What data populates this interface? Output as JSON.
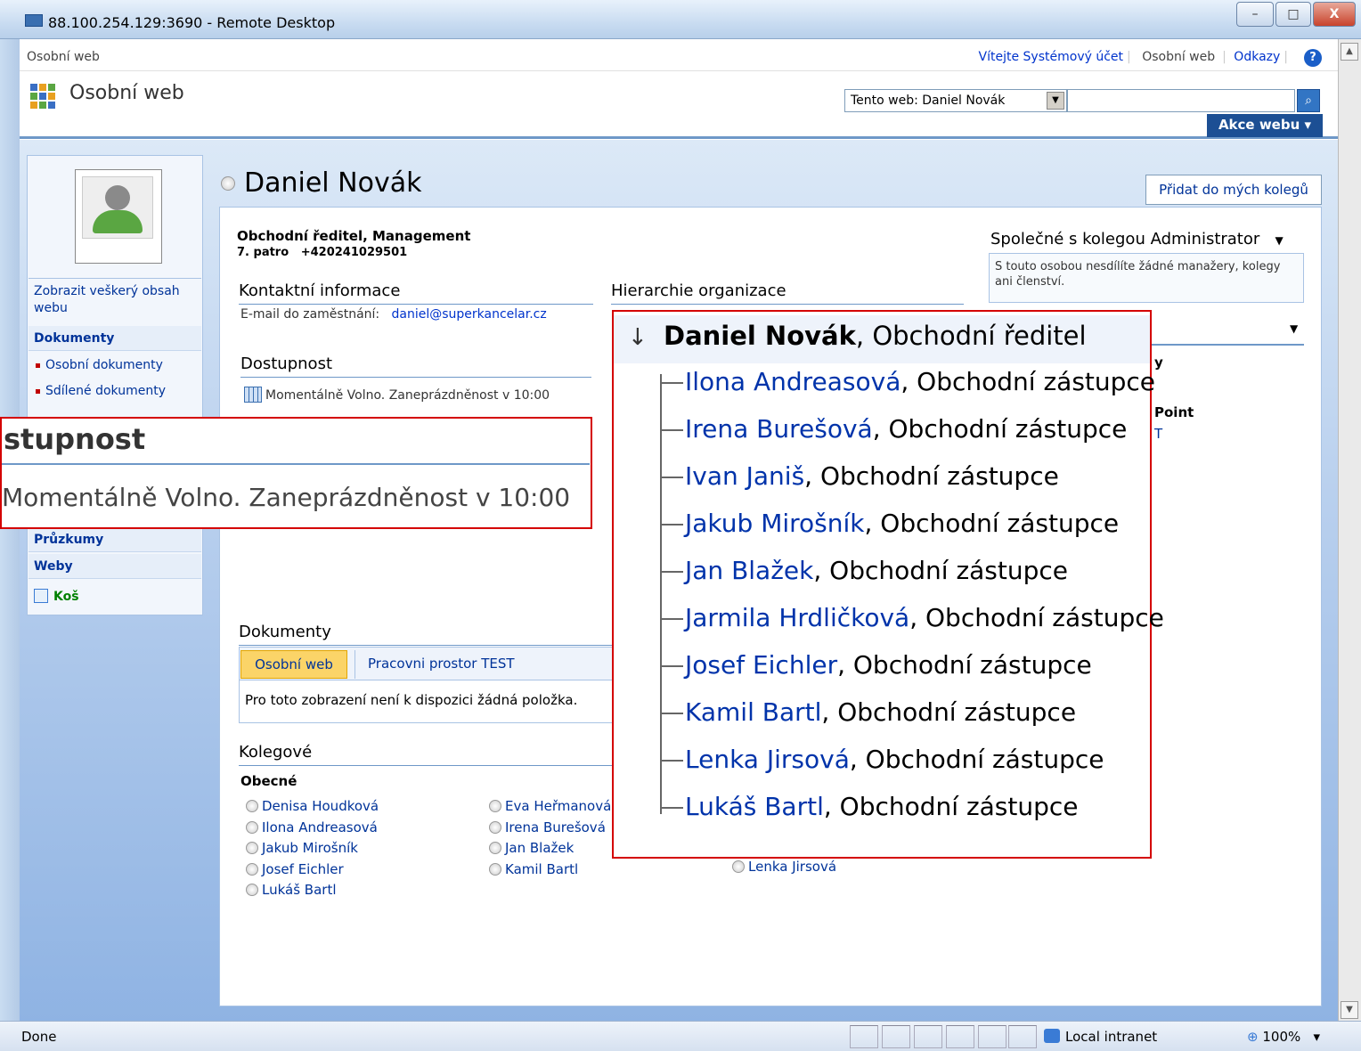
{
  "window": {
    "title": "88.100.254.129:3690 - Remote Desktop",
    "minimize": "–",
    "maximize": "□",
    "close": "X"
  },
  "topbar": {
    "site": "Osobní web",
    "welcome": "Vítejte Systémový účet",
    "my_site": "Osobní web",
    "links": "Odkazy",
    "help": "?"
  },
  "header": {
    "title": "Osobní web",
    "scope": "Tento web: Daniel Novák",
    "search_placeholder": "",
    "site_actions": "Akce webu ▾"
  },
  "nav": {
    "view_all": "Zobrazit veškerý obsah webu",
    "documents": "Dokumenty",
    "doc_items": [
      "Osobní dokumenty",
      "Sdílené dokumenty"
    ],
    "surveys": "Průzkumy",
    "sites": "Weby",
    "recycle": "Koš"
  },
  "person": {
    "name": "Daniel Novák",
    "add_colleague": "Přidat do mých kolegů",
    "title_line": "Obchodní ředitel, Management",
    "floor": "7. patro",
    "phone": "+420241029501"
  },
  "contact": {
    "heading": "Kontaktní informace",
    "email_label": "E-mail do zaměstnání:",
    "email": "daniel@superkancelar.cz"
  },
  "availability": {
    "heading": "Dostupnost",
    "status": "Momentálně Volno. Zaneprázdněnost v 10:00"
  },
  "availability_zoom": {
    "heading": "stupnost",
    "status": "Momentálně Volno. Zaneprázdněnost v 10:00"
  },
  "hierarchy": {
    "heading": "Hierarchie organizace",
    "manager_name": "Daniel Novák",
    "manager_role": ", Obchodní ředitel",
    "reports": [
      {
        "name": "Ilona Andreasová",
        "role": ", Obchodní zástupce"
      },
      {
        "name": "Irena Burešová",
        "role": ", Obchodní zástupce"
      },
      {
        "name": "Ivan Janiš",
        "role": ", Obchodní zástupce"
      },
      {
        "name": "Jakub Mirošník",
        "role": ", Obchodní zástupce"
      },
      {
        "name": "Jan Blažek",
        "role": ", Obchodní zástupce"
      },
      {
        "name": "Jarmila Hrdličková",
        "role": ", Obchodní zástupce"
      },
      {
        "name": "Josef Eichler",
        "role": ", Obchodní zástupce"
      },
      {
        "name": "Kamil Bartl",
        "role": ", Obchodní zástupce"
      },
      {
        "name": "Lenka Jirsová",
        "role": ", Obchodní zástupce"
      },
      {
        "name": "Lukáš Bartl",
        "role": ", Obchodní zástupce"
      }
    ]
  },
  "in_common": {
    "heading": "Společné s kolegou Administrator",
    "text": "S touto osobou nesdílíte žádné manažery, kolegy ani členství.",
    "partial_y": "y",
    "partial_point": "Point",
    "partial_t": "T"
  },
  "documents": {
    "heading": "Dokumenty",
    "tabs": [
      "Osobní web",
      "Pracovni prostor TEST"
    ],
    "empty": "Pro toto zobrazení není k dispozici žádná položka."
  },
  "colleagues": {
    "heading": "Kolegové",
    "group": "Obecné",
    "col1": [
      "Denisa Houdková",
      "Ilona Andreasová",
      "Jakub Mirošník",
      "Josef Eichler",
      "Lukáš Bartl"
    ],
    "col2": [
      "Eva Heřmanová",
      "Irena Burešová",
      "Jan Blažek",
      "Kamil Bartl"
    ],
    "col3": [
      "Lenka Jirsová"
    ]
  },
  "statusbar": {
    "done": "Done",
    "zone": "Local intranet",
    "zoom": "100%"
  }
}
